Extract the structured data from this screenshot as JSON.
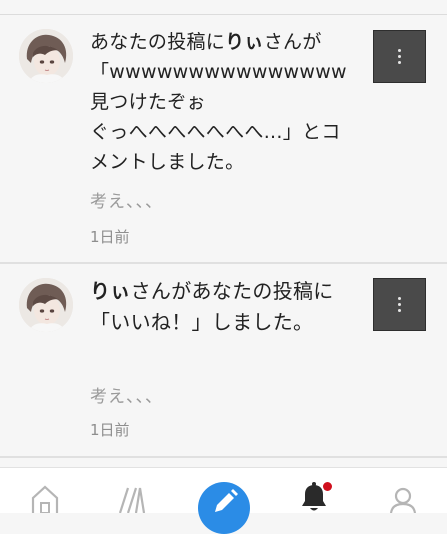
{
  "notifications": [
    {
      "user": "りぃ",
      "message_prefix": "あなたの投稿に",
      "message_suffix": "さんが\n「wwwwwwwwwwwwwww\n見つけたぞぉ\nぐっへへへへへへへ...」とコメントしました。",
      "excerpt": "考え、、、",
      "time": "1日前"
    },
    {
      "user": "りぃ",
      "message_prefix": "",
      "message_suffix": "さんがあなたの投稿に「いいね！」しました。",
      "excerpt": "考え、、、",
      "time": "1日前"
    }
  ],
  "bottom_nav": {
    "items": [
      "home-icon",
      "library-icon",
      "compose-icon",
      "notification-bell-icon",
      "profile-icon"
    ],
    "accent_color": "#2b8ce6",
    "badge_color": "#d0101e"
  }
}
